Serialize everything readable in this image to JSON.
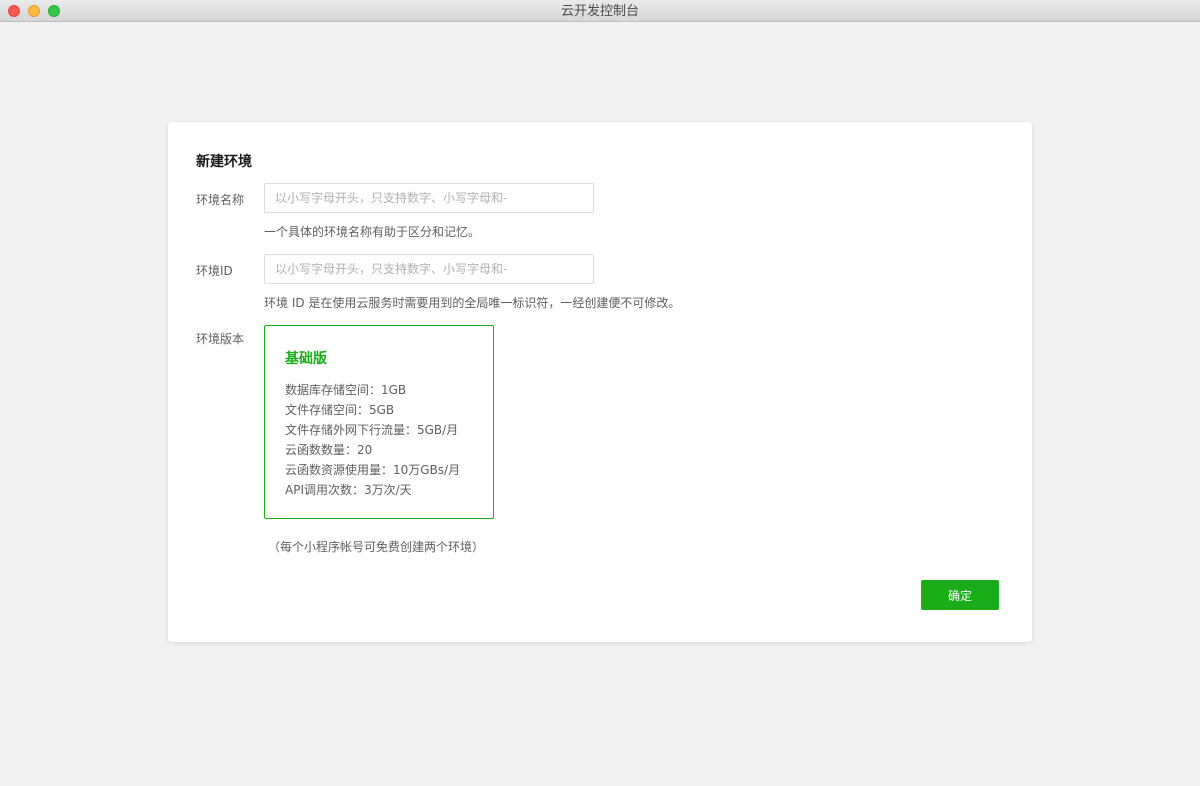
{
  "window": {
    "title": "云开发控制台"
  },
  "form": {
    "heading": "新建环境",
    "env_name": {
      "label": "环境名称",
      "value": "",
      "placeholder": "以小写字母开头，只支持数字、小写字母和-",
      "hint": "一个具体的环境名称有助于区分和记忆。"
    },
    "env_id": {
      "label": "环境ID",
      "value": "",
      "placeholder": "以小写字母开头，只支持数字、小写字母和-",
      "hint": "环境 ID 是在使用云服务时需要用到的全局唯一标识符，一经创建便不可修改。"
    },
    "version": {
      "label": "环境版本",
      "plan": {
        "name": "基础版",
        "features": [
          "数据库存储空间：1GB",
          "文件存储空间：5GB",
          "文件存储外网下行流量：5GB/月",
          "云函数数量：20",
          "云函数资源使用量：10万GBs/月",
          "API调用次数：3万次/天"
        ]
      },
      "note": "（每个小程序帐号可免费创建两个环境）"
    },
    "confirm_label": "确定"
  },
  "colors": {
    "accent": "#1aad19",
    "background": "#f2f2f2",
    "card": "#ffffff"
  }
}
